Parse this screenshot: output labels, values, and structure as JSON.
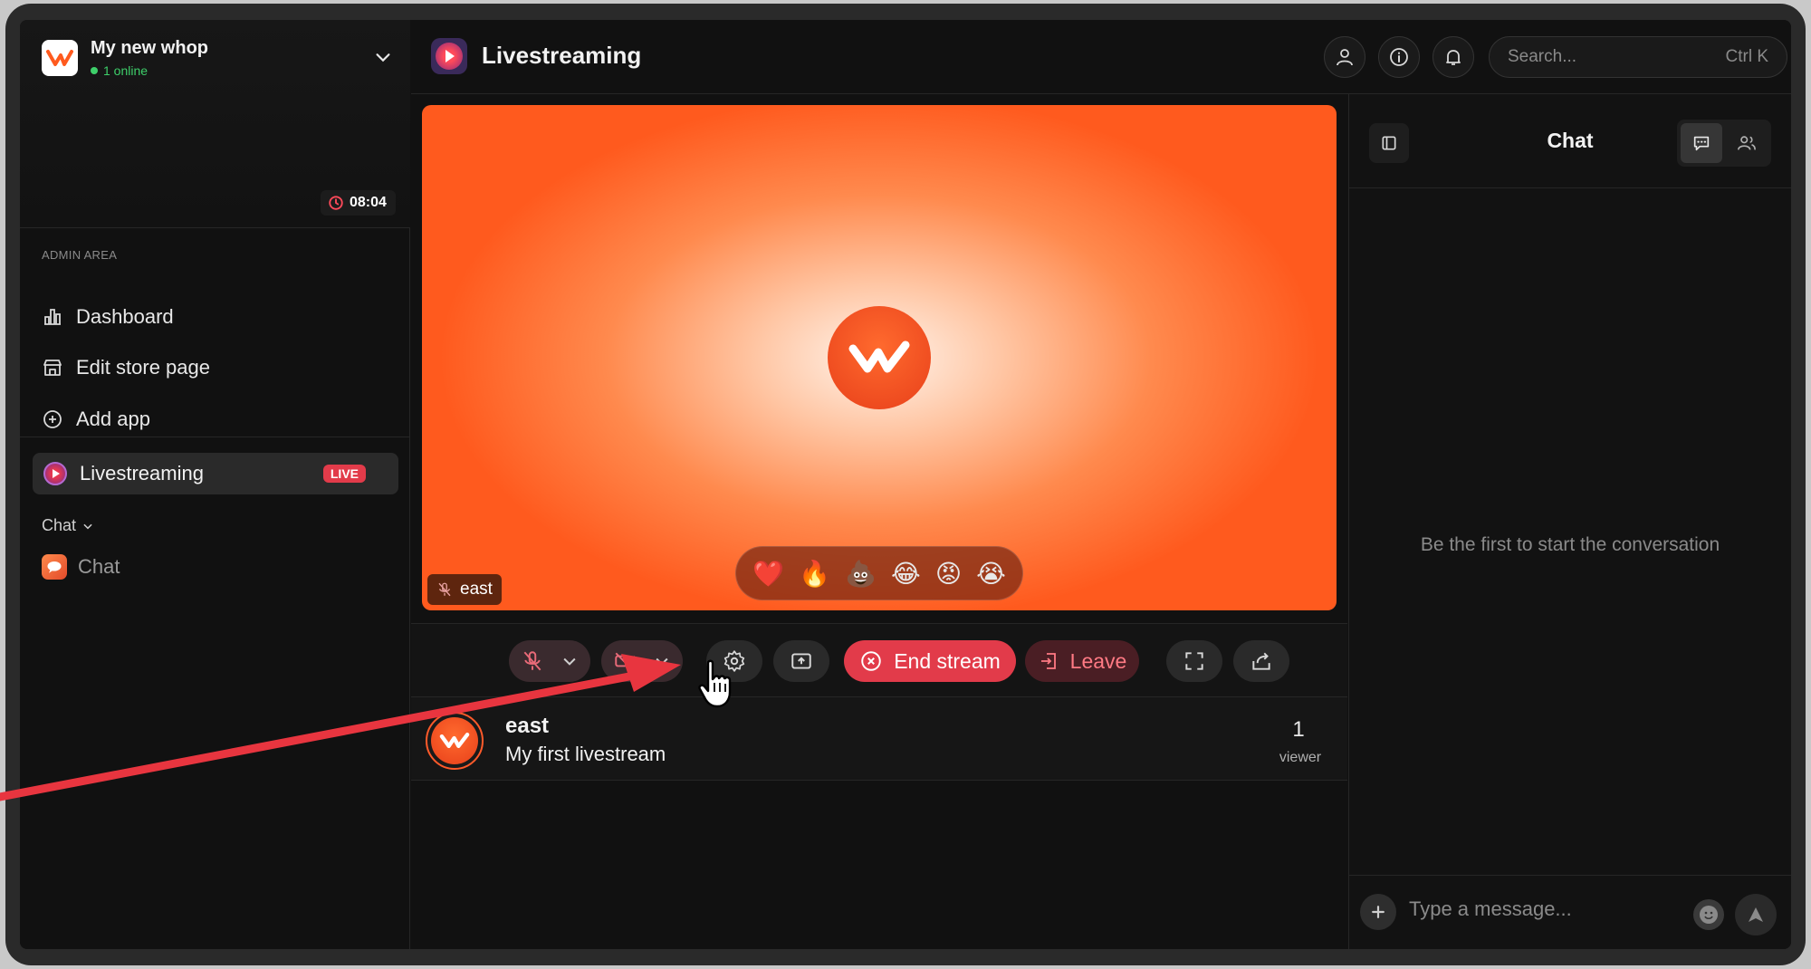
{
  "sidebar": {
    "whop_name": "My new whop",
    "online_status": "1 online",
    "timer": "08:04",
    "admin_label": "ADMIN AREA",
    "nav": [
      {
        "label": "Dashboard",
        "icon": "bar-chart-icon"
      },
      {
        "label": "Edit store page",
        "icon": "store-icon"
      },
      {
        "label": "Add app",
        "icon": "plus-circle-icon"
      }
    ],
    "live_item": {
      "label": "Livestreaming",
      "badge": "LIVE"
    },
    "chat_section": "Chat",
    "chat_item": "Chat"
  },
  "topbar": {
    "title": "Livestreaming",
    "search_placeholder": "Search...",
    "search_shortcut": "Ctrl K"
  },
  "stage": {
    "participant_name": "east",
    "reactions": [
      "❤️",
      "🔥",
      "💩",
      "😂",
      "😡",
      "😭"
    ]
  },
  "controls": {
    "end_stream_label": "End stream",
    "leave_label": "Leave"
  },
  "stream": {
    "host": "east",
    "title": "My first livestream",
    "viewer_count": "1",
    "viewer_label": "viewer"
  },
  "chat_panel": {
    "title": "Chat",
    "empty_message": "Be the first to start the conversation",
    "input_placeholder": "Type a message..."
  },
  "colors": {
    "accent_red": "#e23b4a",
    "stage_orange": "#ff5a1e",
    "online_green": "#3ecf6a"
  }
}
